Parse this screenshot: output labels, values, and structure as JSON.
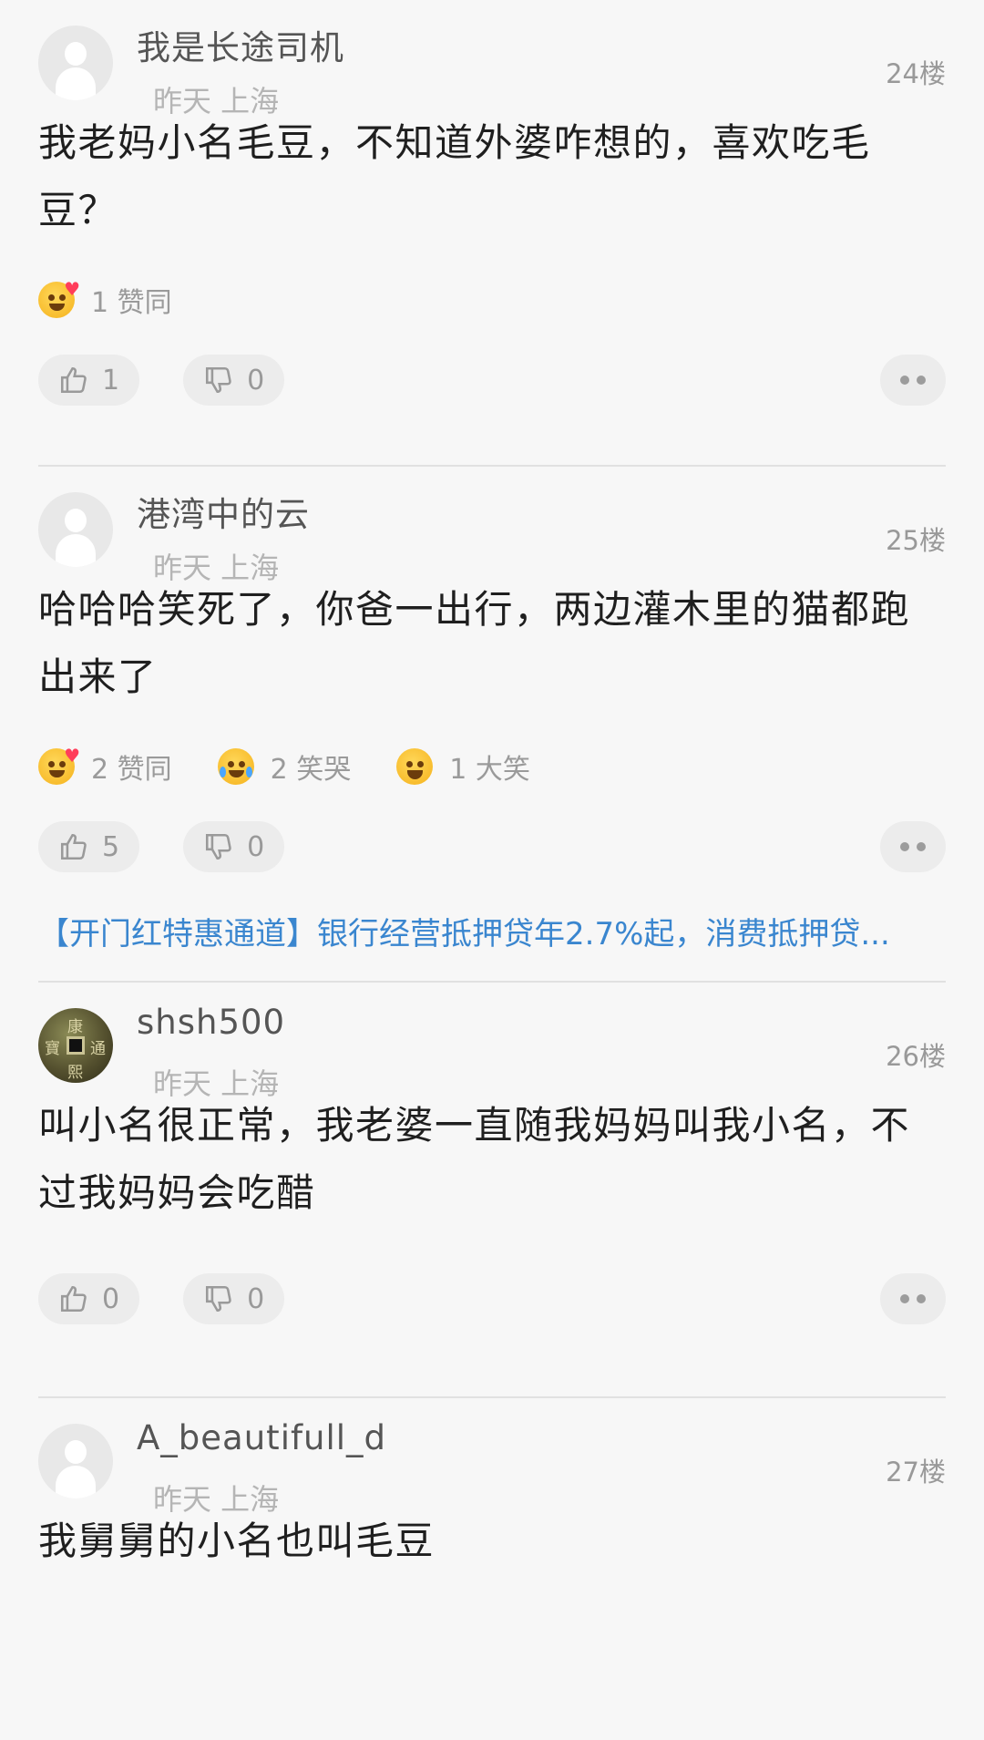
{
  "posts": [
    {
      "username": "我是长途司机",
      "meta": "昨天 上海",
      "floor": "24楼",
      "content": "我老妈小名毛豆，不知道外婆咋想的，喜欢吃毛豆？",
      "reactions": [
        {
          "icon": "heart-eyes-emoji-icon",
          "text": "1 赞同"
        }
      ],
      "likes": "1",
      "dislikes": "0"
    },
    {
      "username": "港湾中的云",
      "meta": "昨天 上海",
      "floor": "25楼",
      "content": "哈哈哈笑死了，你爸一出行，两边灌木里的猫都跑出来了",
      "reactions": [
        {
          "icon": "heart-eyes-emoji-icon",
          "text": "2 赞同"
        },
        {
          "icon": "laugh-cry-emoji-icon",
          "text": "2 笑哭"
        },
        {
          "icon": "big-laugh-emoji-icon",
          "text": "1 大笑"
        }
      ],
      "likes": "5",
      "dislikes": "0"
    },
    {
      "username": "shsh500",
      "meta": "昨天 上海",
      "floor": "26楼",
      "content": "叫小名很正常，我老婆一直随我妈妈叫我小名，不过我妈妈会吃醋",
      "likes": "0",
      "dislikes": "0",
      "avatar_glyphs": [
        "康",
        "通",
        "寶",
        "熙"
      ]
    },
    {
      "username": "A_beautifull_d",
      "meta": "昨天 上海",
      "floor": "27楼",
      "content": "我舅舅的小名也叫毛豆"
    }
  ],
  "ad": {
    "text": "【开门红特惠通道】银行经营抵押贷年2.7%起，消费抵押贷..."
  },
  "colors": {
    "accent": "#3a86cf",
    "background": "#f7f7f7"
  }
}
